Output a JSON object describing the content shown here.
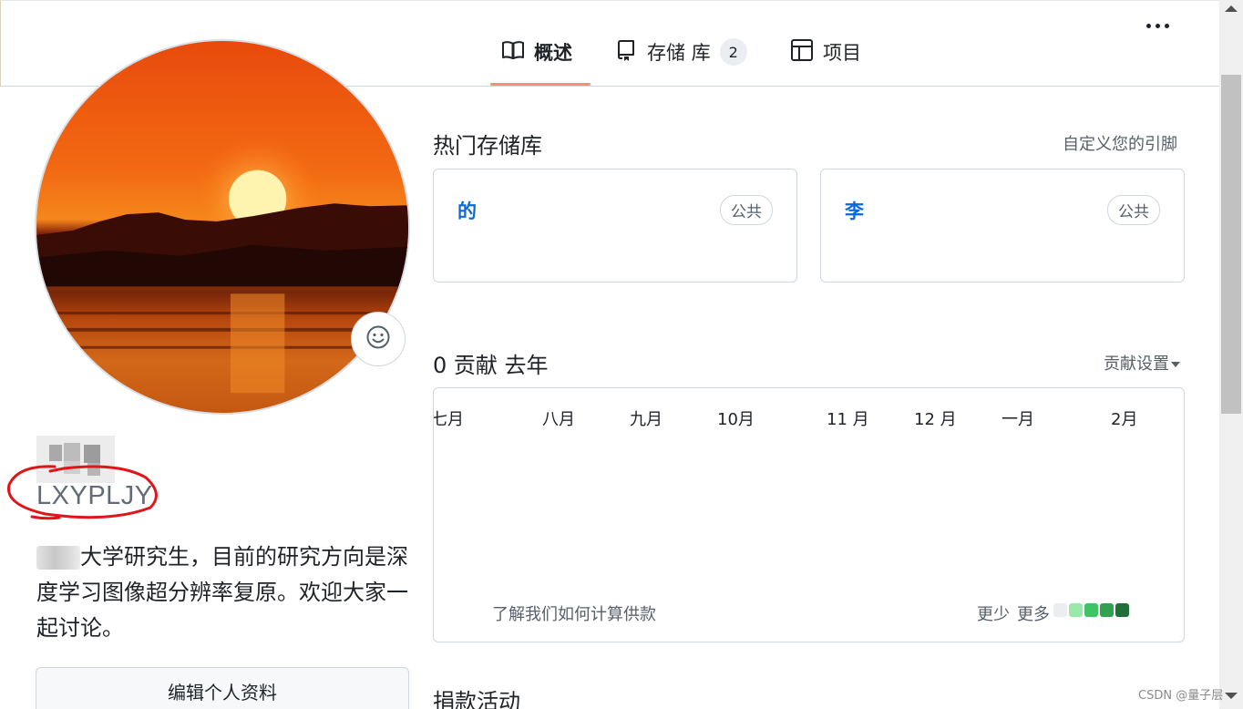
{
  "tabs": [
    {
      "label": "概述",
      "icon": "book-icon",
      "active": true
    },
    {
      "label": "存储 库",
      "icon": "repo-icon",
      "count": "2"
    },
    {
      "label": "项目",
      "icon": "table-icon"
    }
  ],
  "profile": {
    "login": "LXYPLJY",
    "bio": "大学研究生，目前的研究方向是深度学习图像超分辨率复原。欢迎大家一起讨论。",
    "edit_label": "编辑个人资料"
  },
  "popular": {
    "title": "热门存储库",
    "customize_link": "自定义您的引脚",
    "repos": [
      {
        "name": "的",
        "visibility": "公共"
      },
      {
        "name": "李",
        "visibility": "公共"
      }
    ]
  },
  "contributions": {
    "title": "0 贡献 去年",
    "settings_label": "贡献设置",
    "months": [
      "七月",
      "八月",
      "九月",
      "10月",
      "11 月",
      "12 月",
      "一月",
      "2月"
    ],
    "learn_link": "了解我们如何计算供款",
    "less_label": "更少",
    "more_label": "更多",
    "legend_colors": [
      "#ebedf0",
      "#9be9a8",
      "#40c463",
      "#30a14e",
      "#216e39"
    ]
  },
  "donation": {
    "title": "捐款活动"
  },
  "watermark": "CSDN @量子层"
}
